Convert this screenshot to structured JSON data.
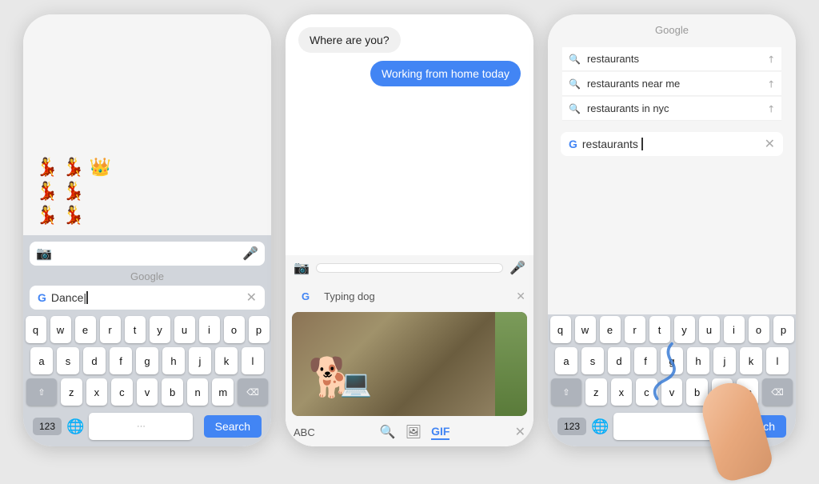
{
  "phone1": {
    "label": "emoji-search-phone",
    "emojiRows": [
      [
        "💃",
        "💃",
        "👑"
      ],
      [
        "💃",
        "💃"
      ],
      [
        "💃",
        "💃"
      ]
    ],
    "googleLabel": "Google",
    "query": "Dance",
    "cursor": "|",
    "keyboard": {
      "rows": [
        [
          "q",
          "w",
          "e",
          "r",
          "t",
          "y",
          "u",
          "i",
          "o",
          "p"
        ],
        [
          "a",
          "s",
          "d",
          "f",
          "g",
          "h",
          "j",
          "k",
          "l"
        ],
        [
          "z",
          "x",
          "c",
          "v",
          "b",
          "n",
          "m"
        ]
      ],
      "numLabel": "123",
      "globeLabel": "🌐",
      "spaceLabel": "···",
      "searchLabel": "Search"
    }
  },
  "phone2": {
    "label": "chat-gif-phone",
    "messages": [
      {
        "text": "Where are you?",
        "type": "received"
      },
      {
        "text": "Working from home today",
        "type": "sent"
      }
    ],
    "inputPlaceholder": "",
    "gboardQuery": "Typing dog",
    "tabs": {
      "abc": "ABC",
      "search": "🔍",
      "image": "🖼",
      "gif": "GIF"
    }
  },
  "phone3": {
    "label": "swipe-keyboard-phone",
    "googleLabel": "Google",
    "suggestions": [
      {
        "text": "restaurants",
        "hasArrow": true
      },
      {
        "text": "restaurants near me",
        "hasArrow": true
      },
      {
        "text": "restaurants in nyc",
        "hasArrow": true
      }
    ],
    "activeQuery": "restaurants",
    "keyboard": {
      "rows": [
        [
          "q",
          "w",
          "e",
          "r",
          "t",
          "y",
          "u",
          "i",
          "o",
          "p"
        ],
        [
          "a",
          "s",
          "d",
          "f",
          "g",
          "h",
          "j",
          "k",
          "l"
        ],
        [
          "z",
          "x",
          "c",
          "v",
          "b",
          "n",
          "m"
        ]
      ],
      "numLabel": "123",
      "globeLabel": "🌐",
      "searchLabel": "earch"
    }
  },
  "colors": {
    "blue": "#4285F4",
    "keyBg": "#ffffff",
    "darkKey": "#aeb3bb",
    "bg": "#d1d5db"
  }
}
